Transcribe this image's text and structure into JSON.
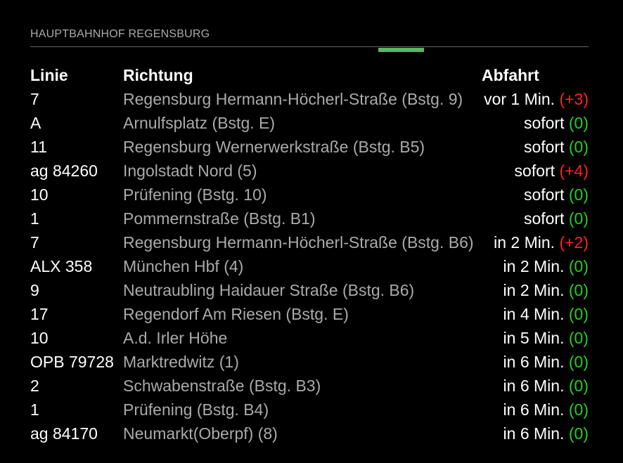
{
  "header": {
    "title": "HAUPTBAHNHOF REGENSBURG"
  },
  "colors": {
    "accent": "#5cb85c",
    "delay_late": "#ff2020",
    "delay_ok": "#22d022",
    "direction_text": "#aaaaaa"
  },
  "table": {
    "headers": {
      "line": "Linie",
      "direction": "Richtung",
      "departure": "Abfahrt"
    },
    "rows": [
      {
        "line": "7",
        "direction": "Regensburg Hermann-Höcherl-Straße (Bstg. 9)",
        "time": "vor 1 Min.",
        "delay": "(+3)",
        "delay_status": "late"
      },
      {
        "line": "A",
        "direction": "Arnulfsplatz (Bstg. E)",
        "time": "sofort",
        "delay": "(0)",
        "delay_status": "ok"
      },
      {
        "line": "11",
        "direction": "Regensburg Wernerwerkstraße (Bstg. B5)",
        "time": "sofort",
        "delay": "(0)",
        "delay_status": "ok"
      },
      {
        "line": "ag 84260",
        "direction": "Ingolstadt Nord (5)",
        "time": "sofort",
        "delay": "(+4)",
        "delay_status": "late"
      },
      {
        "line": "10",
        "direction": "Prüfening (Bstg. 10)",
        "time": "sofort",
        "delay": "(0)",
        "delay_status": "ok"
      },
      {
        "line": "1",
        "direction": "Pommernstraße (Bstg. B1)",
        "time": "sofort",
        "delay": "(0)",
        "delay_status": "ok"
      },
      {
        "line": "7",
        "direction": "Regensburg Hermann-Höcherl-Straße (Bstg. B6)",
        "time": "in 2 Min.",
        "delay": "(+2)",
        "delay_status": "late"
      },
      {
        "line": "ALX 358",
        "direction": "München Hbf (4)",
        "time": "in 2 Min.",
        "delay": "(0)",
        "delay_status": "ok"
      },
      {
        "line": "9",
        "direction": "Neutraubling Haidauer Straße (Bstg. B6)",
        "time": "in 2 Min.",
        "delay": "(0)",
        "delay_status": "ok"
      },
      {
        "line": "17",
        "direction": "Regendorf Am Riesen (Bstg. E)",
        "time": "in 4 Min.",
        "delay": "(0)",
        "delay_status": "ok"
      },
      {
        "line": "10",
        "direction": "A.d. Irler Höhe",
        "time": "in 5 Min.",
        "delay": "(0)",
        "delay_status": "ok"
      },
      {
        "line": "OPB 79728",
        "direction": "Marktredwitz (1)",
        "time": "in 6 Min.",
        "delay": "(0)",
        "delay_status": "ok"
      },
      {
        "line": "2",
        "direction": "Schwabenstraße (Bstg. B3)",
        "time": "in 6 Min.",
        "delay": "(0)",
        "delay_status": "ok"
      },
      {
        "line": "1",
        "direction": "Prüfening (Bstg. B4)",
        "time": "in 6 Min.",
        "delay": "(0)",
        "delay_status": "ok"
      },
      {
        "line": "ag 84170",
        "direction": "Neumarkt(Oberpf) (8)",
        "time": "in 6 Min.",
        "delay": "(0)",
        "delay_status": "ok"
      }
    ]
  }
}
